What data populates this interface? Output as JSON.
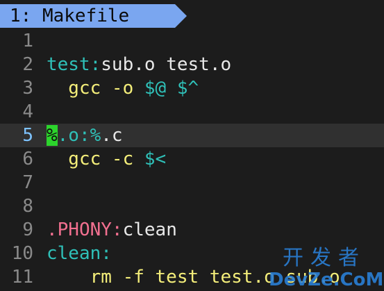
{
  "tab": {
    "label": "1: Makefile"
  },
  "lines": [
    {
      "num": "1",
      "parts": []
    },
    {
      "num": "2",
      "parts": [
        {
          "text": "test:",
          "cls": "kw-target"
        },
        {
          "text": "sub.o test.o",
          "cls": "kw-white"
        }
      ]
    },
    {
      "num": "3",
      "parts": [
        {
          "text": "  gcc -o ",
          "cls": "kw-yellow"
        },
        {
          "text": "$@ $^",
          "cls": "kw-var"
        }
      ]
    },
    {
      "num": "4",
      "parts": []
    },
    {
      "num": "5",
      "current": true,
      "parts": [
        {
          "text": "%",
          "cls": "cursor"
        },
        {
          "text": ".o:%",
          "cls": "kw-target"
        },
        {
          "text": ".c",
          "cls": "kw-white"
        }
      ]
    },
    {
      "num": "6",
      "parts": [
        {
          "text": "  gcc -c ",
          "cls": "kw-yellow"
        },
        {
          "text": "$<",
          "cls": "kw-var"
        }
      ]
    },
    {
      "num": "7",
      "parts": []
    },
    {
      "num": "8",
      "parts": []
    },
    {
      "num": "9",
      "parts": [
        {
          "text": ".PHONY:",
          "cls": "kw-red"
        },
        {
          "text": "clean",
          "cls": "kw-white"
        }
      ]
    },
    {
      "num": "10",
      "parts": [
        {
          "text": "clean:",
          "cls": "kw-target"
        }
      ]
    },
    {
      "num": "11",
      "parts": [
        {
          "text": "    rm -f test test.o sub.o",
          "cls": "kw-yellow"
        }
      ]
    }
  ],
  "watermark": {
    "cn": "开发者",
    "en": "DevZe.CoM"
  },
  "colors": {
    "background": "#1c1c1c",
    "tab": "#7aa6f0",
    "target": "#2fc0b8",
    "command": "#f4ee7a",
    "phony": "#f27090",
    "cursor": "#2cd42c",
    "current_line": "#303030"
  }
}
